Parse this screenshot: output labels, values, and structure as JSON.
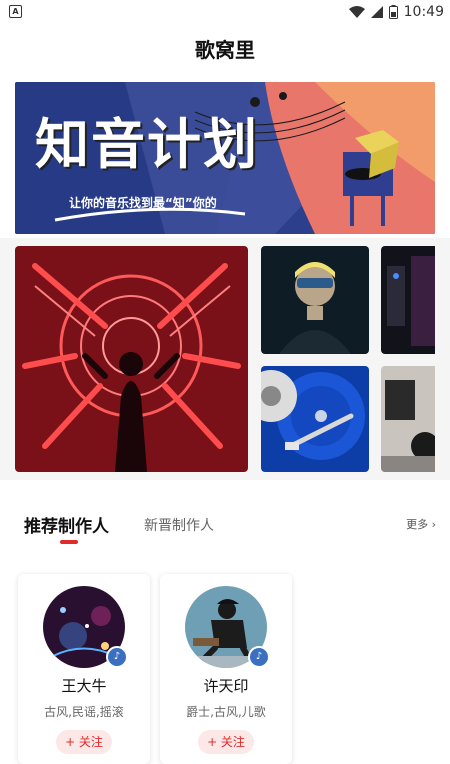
{
  "status_bar": {
    "time": "10:49",
    "left_icon": "A"
  },
  "app_title": "歌窝里",
  "banner": {
    "title": "知音计划",
    "subtitle": "让你的音乐找到最“知”你的"
  },
  "tabs": [
    {
      "label": "推荐制作人",
      "active": true
    },
    {
      "label": "新晋制作人",
      "active": false
    }
  ],
  "more_label": "更多",
  "producers": [
    {
      "name": "王大牛",
      "tags": "古风,民谣,摇滚",
      "follow_label": "+ 关注"
    },
    {
      "name": "许天印",
      "tags": "爵士,古风,儿歌",
      "follow_label": "+ 关注"
    }
  ],
  "colors": {
    "accent": "#e02b2b",
    "badge": "#3b6fc2"
  }
}
